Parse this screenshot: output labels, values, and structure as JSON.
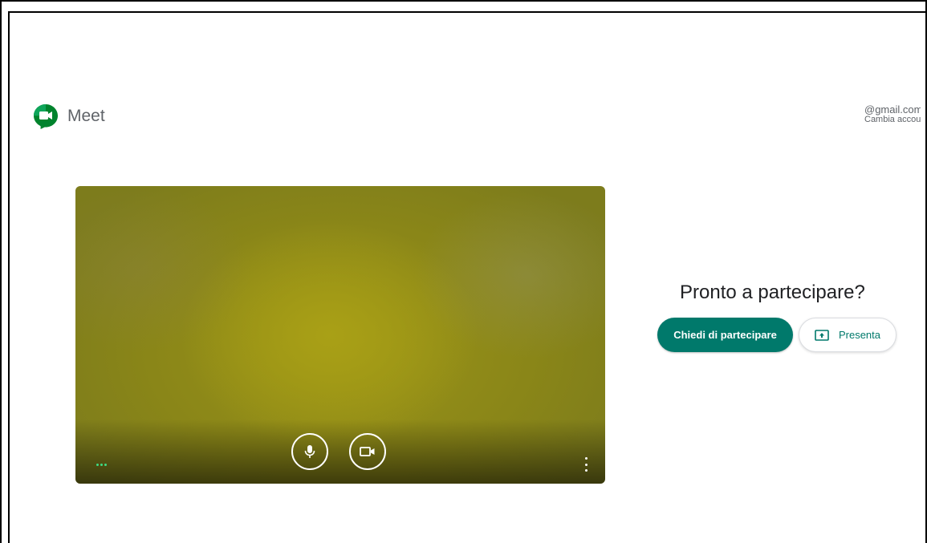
{
  "app": {
    "name": "Meet"
  },
  "account": {
    "email": "@gmail.com",
    "switch_label": "Cambia account"
  },
  "preview": {
    "mic_icon": "microphone-icon",
    "camera_icon": "video-camera-icon",
    "more_icon": "more-vert-icon"
  },
  "join": {
    "title": "Pronto a partecipare?",
    "ask_join_label": "Chiedi di partecipare",
    "present_label": "Presenta",
    "present_icon": "present-to-all-icon"
  },
  "colors": {
    "accent": "#00796b",
    "logo_green": "#00832d",
    "logo_yellow": "#ffba00"
  }
}
